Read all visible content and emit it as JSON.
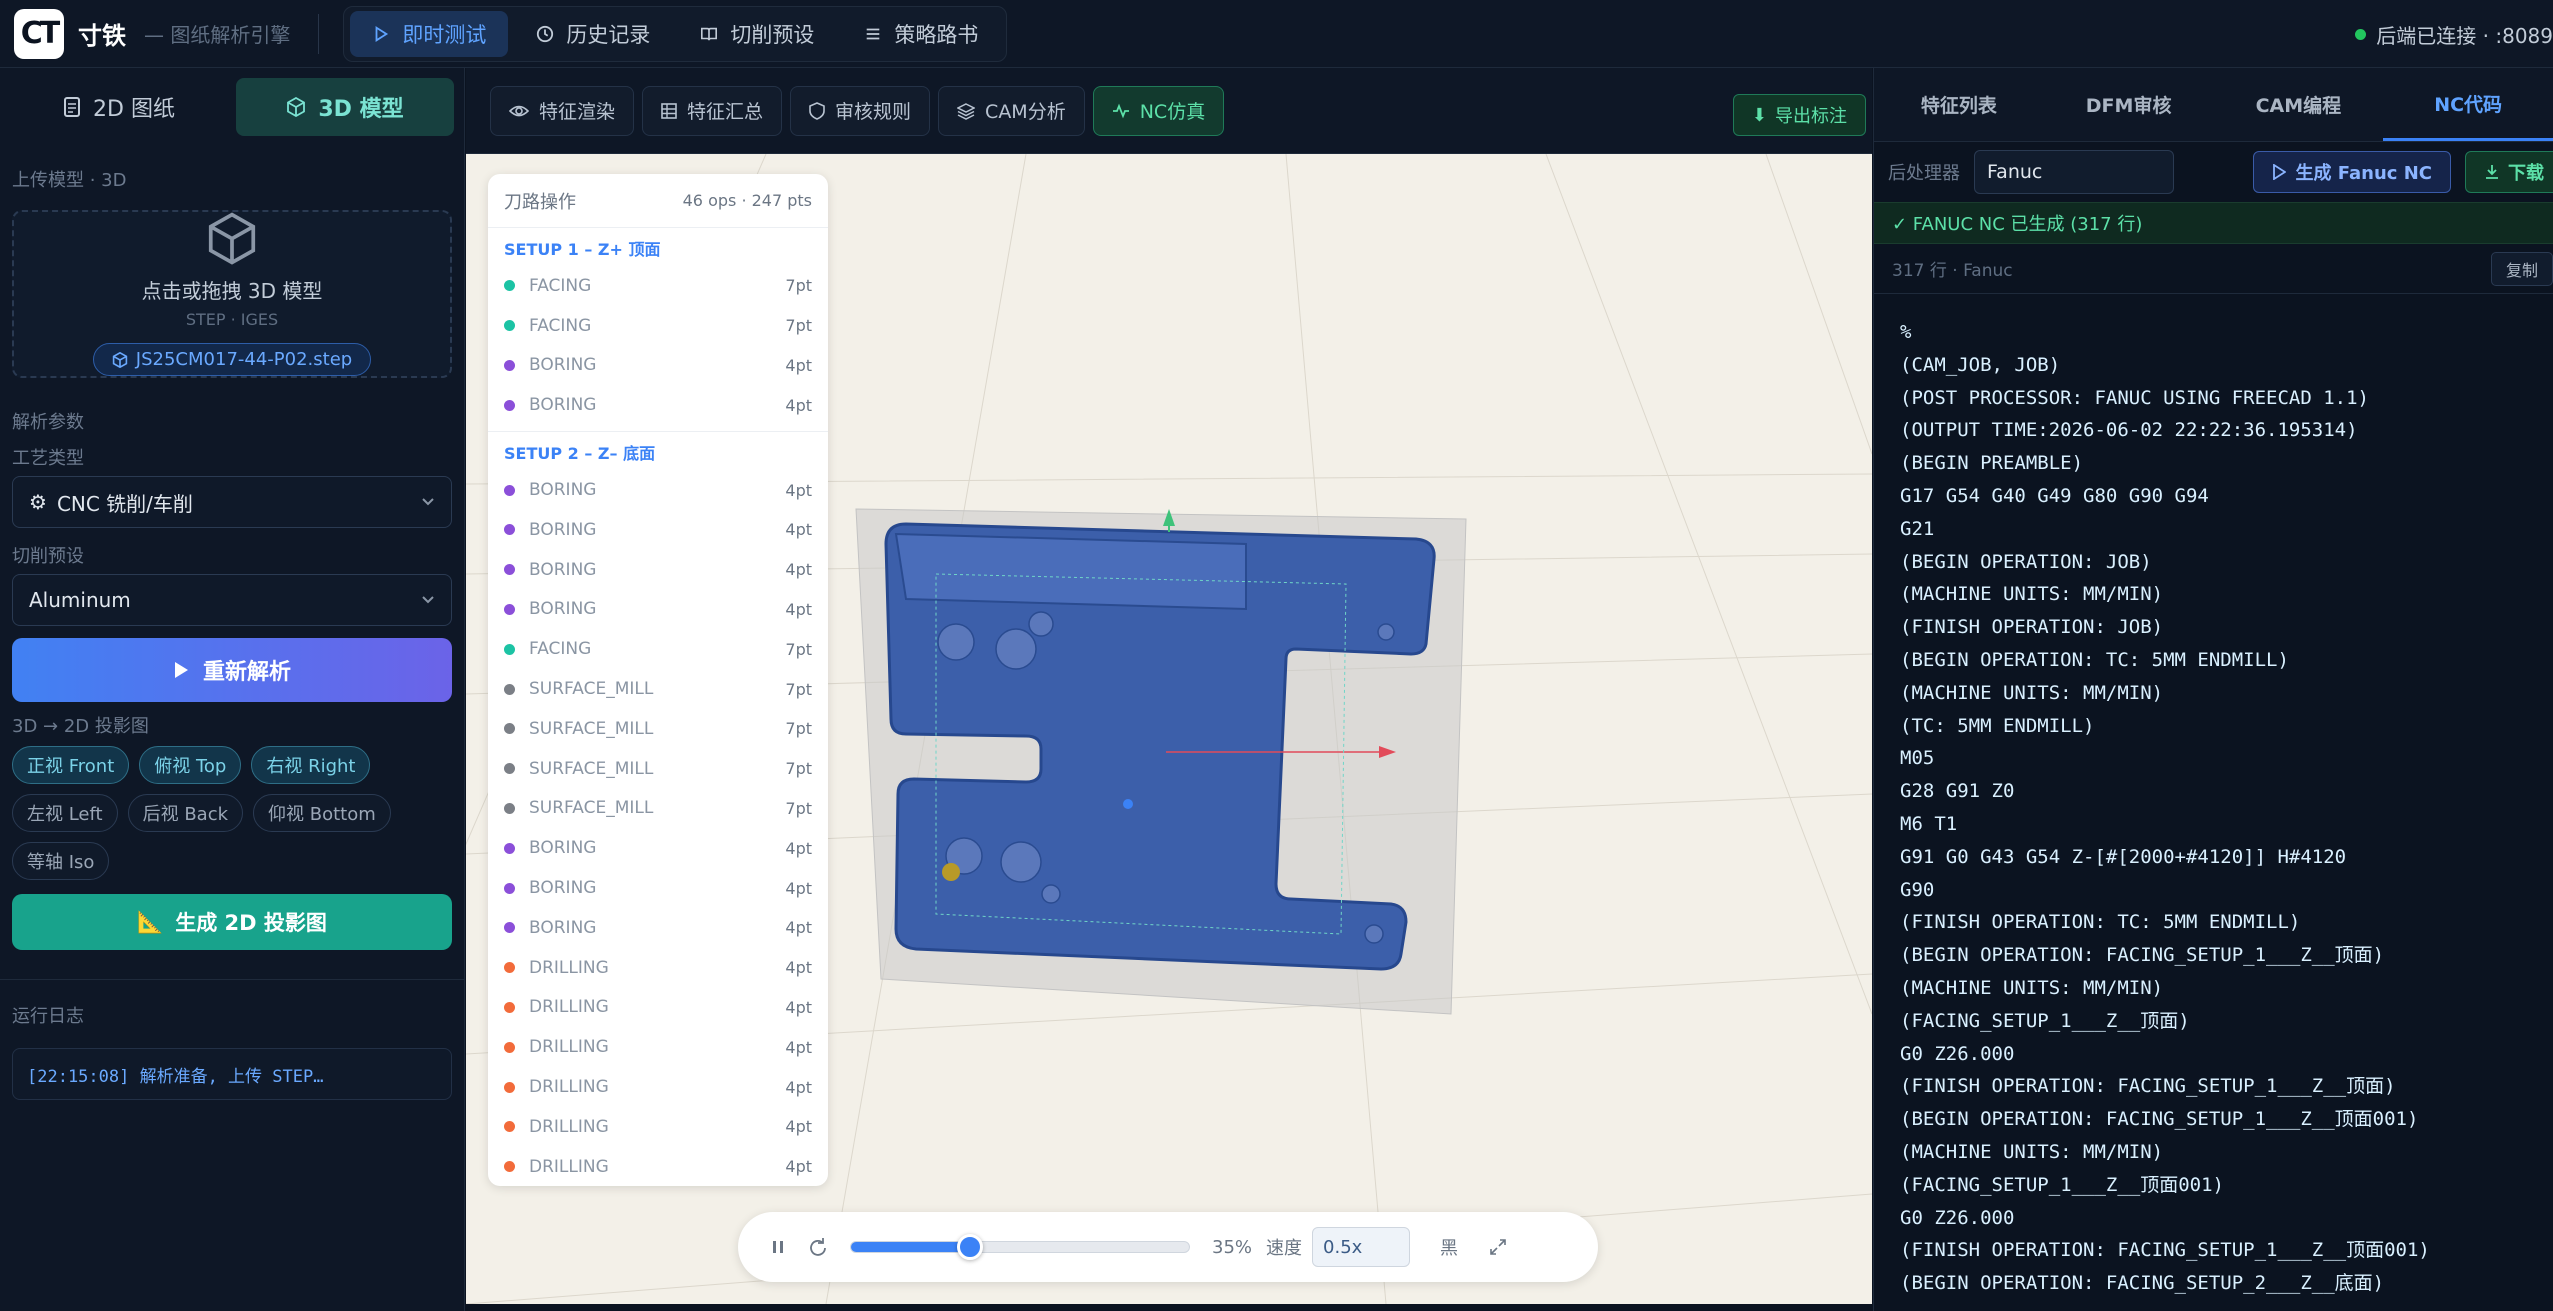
{
  "app": {
    "logo": "CT",
    "name": "寸铁",
    "subtitle": "— 图纸解析引擎"
  },
  "topnav": [
    {
      "label": "即时测试",
      "icon": "play-icon",
      "active": true
    },
    {
      "label": "历史记录",
      "icon": "clock-icon",
      "active": false
    },
    {
      "label": "切削预设",
      "icon": "book-icon",
      "active": false
    },
    {
      "label": "策略路书",
      "icon": "list-icon",
      "active": false
    }
  ],
  "status": {
    "text": "后端已连接 · :8089",
    "color": "#22c55e"
  },
  "left": {
    "tabs": [
      {
        "label": "2D 图纸",
        "active": false
      },
      {
        "label": "3D 模型",
        "active": true
      }
    ],
    "upload_section": "上传模型 · 3D",
    "upload_title": "点击或拖拽 3D 模型",
    "upload_formats": "STEP · IGES",
    "file_name": "JS25CM017-44-P02.step",
    "params_section": "解析参数",
    "process_label": "工艺类型",
    "process_value": "CNC 铣削/车削",
    "preset_label": "切削预设",
    "preset_value": "Aluminum",
    "reparse_button": "重新解析",
    "proj_section": "3D → 2D 投影图",
    "views": [
      {
        "label": "正视 Front",
        "on": true
      },
      {
        "label": "俯视 Top",
        "on": true
      },
      {
        "label": "右视 Right",
        "on": true
      },
      {
        "label": "左视 Left",
        "on": false
      },
      {
        "label": "后视 Back",
        "on": false
      },
      {
        "label": "仰视 Bottom",
        "on": false
      },
      {
        "label": "等轴 Iso",
        "on": false
      }
    ],
    "gen_proj_button": "生成 2D 投影图",
    "log_section": "运行日志",
    "log_line": "[22:15:08] 解析准备, 上传 STEP…"
  },
  "center": {
    "tools": [
      {
        "label": "特征渲染",
        "icon": "eye-icon",
        "on": false
      },
      {
        "label": "特征汇总",
        "icon": "table-icon",
        "on": false
      },
      {
        "label": "审核规则",
        "icon": "shield-icon",
        "on": false
      },
      {
        "label": "CAM分析",
        "icon": "layers-icon",
        "on": false
      },
      {
        "label": "NC仿真",
        "icon": "pulse-icon",
        "on": true
      }
    ],
    "export_button": "导出标注",
    "ops_title": "刀路操作",
    "ops_summary": "46 ops · 247 pts",
    "setups": [
      {
        "title": "SETUP 1 – Z+ 顶面",
        "ops": [
          {
            "name": "FACING",
            "pts": "7pt",
            "color": "#1cc3a4"
          },
          {
            "name": "FACING",
            "pts": "7pt",
            "color": "#1cc3a4"
          },
          {
            "name": "BORING",
            "pts": "4pt",
            "color": "#8b4fd9"
          },
          {
            "name": "BORING",
            "pts": "4pt",
            "color": "#8b4fd9"
          }
        ]
      },
      {
        "title": "SETUP 2 – Z– 底面",
        "ops": [
          {
            "name": "BORING",
            "pts": "4pt",
            "color": "#8b4fd9"
          },
          {
            "name": "BORING",
            "pts": "4pt",
            "color": "#8b4fd9"
          },
          {
            "name": "BORING",
            "pts": "4pt",
            "color": "#8b4fd9"
          },
          {
            "name": "BORING",
            "pts": "4pt",
            "color": "#8b4fd9"
          },
          {
            "name": "FACING",
            "pts": "7pt",
            "color": "#1cc3a4"
          },
          {
            "name": "SURFACE_MILL",
            "pts": "7pt",
            "color": "#7b7f86"
          },
          {
            "name": "SURFACE_MILL",
            "pts": "7pt",
            "color": "#7b7f86"
          },
          {
            "name": "SURFACE_MILL",
            "pts": "7pt",
            "color": "#7b7f86"
          },
          {
            "name": "SURFACE_MILL",
            "pts": "7pt",
            "color": "#7b7f86"
          },
          {
            "name": "BORING",
            "pts": "4pt",
            "color": "#8b4fd9"
          },
          {
            "name": "BORING",
            "pts": "4pt",
            "color": "#8b4fd9"
          },
          {
            "name": "BORING",
            "pts": "4pt",
            "color": "#8b4fd9"
          },
          {
            "name": "DRILLING",
            "pts": "4pt",
            "color": "#f26b3a"
          },
          {
            "name": "DRILLING",
            "pts": "4pt",
            "color": "#f26b3a"
          },
          {
            "name": "DRILLING",
            "pts": "4pt",
            "color": "#f26b3a"
          },
          {
            "name": "DRILLING",
            "pts": "4pt",
            "color": "#f26b3a"
          },
          {
            "name": "DRILLING",
            "pts": "4pt",
            "color": "#f26b3a"
          },
          {
            "name": "DRILLING",
            "pts": "4pt",
            "color": "#f26b3a"
          }
        ]
      }
    ],
    "progress_text": "35%",
    "progress_value": 0.35,
    "speed_label": "速度",
    "speed_value": "0.5x",
    "mode_label": "黑"
  },
  "right": {
    "tabs": [
      {
        "label": "特征列表",
        "on": false
      },
      {
        "label": "DFM审核",
        "on": false
      },
      {
        "label": "CAM编程",
        "on": false
      },
      {
        "label": "NC代码",
        "on": true
      }
    ],
    "post_label": "后处理器",
    "post_value": "Fanuc",
    "gen_button": "生成 Fanuc NC",
    "download_button": "下载",
    "ok_text": "✓ FANUC NC 已生成 (317 行)",
    "meta_text": "317 行 · Fanuc",
    "copy_button": "复制",
    "code_lines": [
      "%",
      "(CAM_JOB, JOB)",
      "(POST PROCESSOR: FANUC USING FREECAD 1.1)",
      "(OUTPUT TIME:2026-06-02 22:22:36.195314)",
      "(BEGIN PREAMBLE)",
      "G17 G54 G40 G49 G80 G90 G94",
      "G21",
      "(BEGIN OPERATION: JOB)",
      "(MACHINE UNITS: MM/MIN)",
      "(FINISH OPERATION: JOB)",
      "(BEGIN OPERATION: TC: 5MM ENDMILL)",
      "(MACHINE UNITS: MM/MIN)",
      "(TC: 5MM ENDMILL)",
      "M05",
      "G28 G91 Z0",
      "M6 T1",
      "G91 G0 G43 G54 Z-[#[2000+#4120]] H#4120",
      "G90",
      "(FINISH OPERATION: TC: 5MM ENDMILL)",
      "(BEGIN OPERATION: FACING_SETUP_1___Z__顶面)",
      "(MACHINE UNITS: MM/MIN)",
      "(FACING_SETUP_1___Z__顶面)",
      "G0 Z26.000",
      "(FINISH OPERATION: FACING_SETUP_1___Z__顶面)",
      "(BEGIN OPERATION: FACING_SETUP_1___Z__顶面001)",
      "(MACHINE UNITS: MM/MIN)",
      "(FACING_SETUP_1___Z__顶面001)",
      "G0 Z26.000",
      "(FINISH OPERATION: FACING_SETUP_1___Z__顶面001)",
      "(BEGIN OPERATION: FACING_SETUP_2___Z__底面)"
    ]
  }
}
